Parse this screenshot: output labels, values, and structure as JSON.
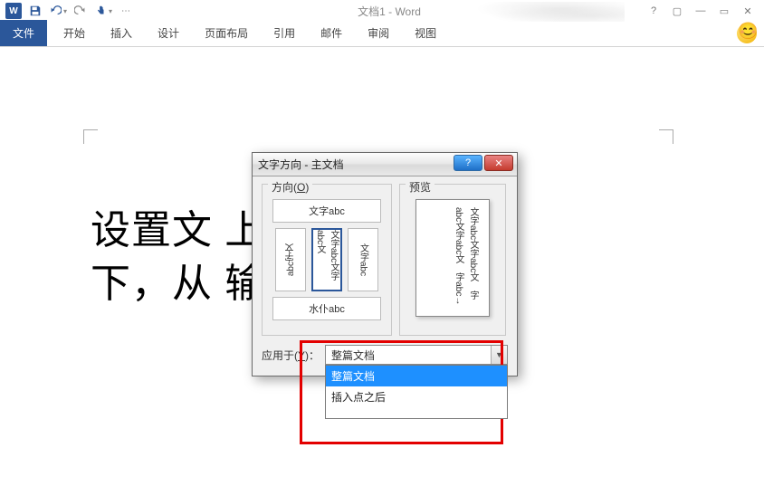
{
  "title": "文档1 - Word",
  "ribbon": {
    "file": "文件",
    "tabs": [
      "开始",
      "插入",
      "设计",
      "页面布局",
      "引用",
      "邮件",
      "审阅",
      "视图"
    ]
  },
  "win_help": "?",
  "win_ribbon": "▢",
  "win_min": "—",
  "win_restore": "▭",
  "win_close": "✕",
  "document": {
    "line1": "设置文                      上到",
    "line2": "下，从                    输入"
  },
  "dialog": {
    "title": "文字方向 - 主文档",
    "help": "?",
    "close": "✕",
    "orientation_label": "方向(O)",
    "preview_label": "预览",
    "opt_h": "文字abc",
    "opt_v1": "abc字文",
    "opt_v2": "文字abc文字abc文",
    "opt_v3": "文字abc",
    "opt_bot": "水仆abc",
    "preview_col1": "字abc→",
    "preview_col2": "字abc文字abc文",
    "preview_col3": "文字abc文字abc文",
    "apply_label": "应用于(Y)：",
    "combo_value": "整篇文档",
    "options": [
      "整篇文档",
      "插入点之后"
    ]
  }
}
